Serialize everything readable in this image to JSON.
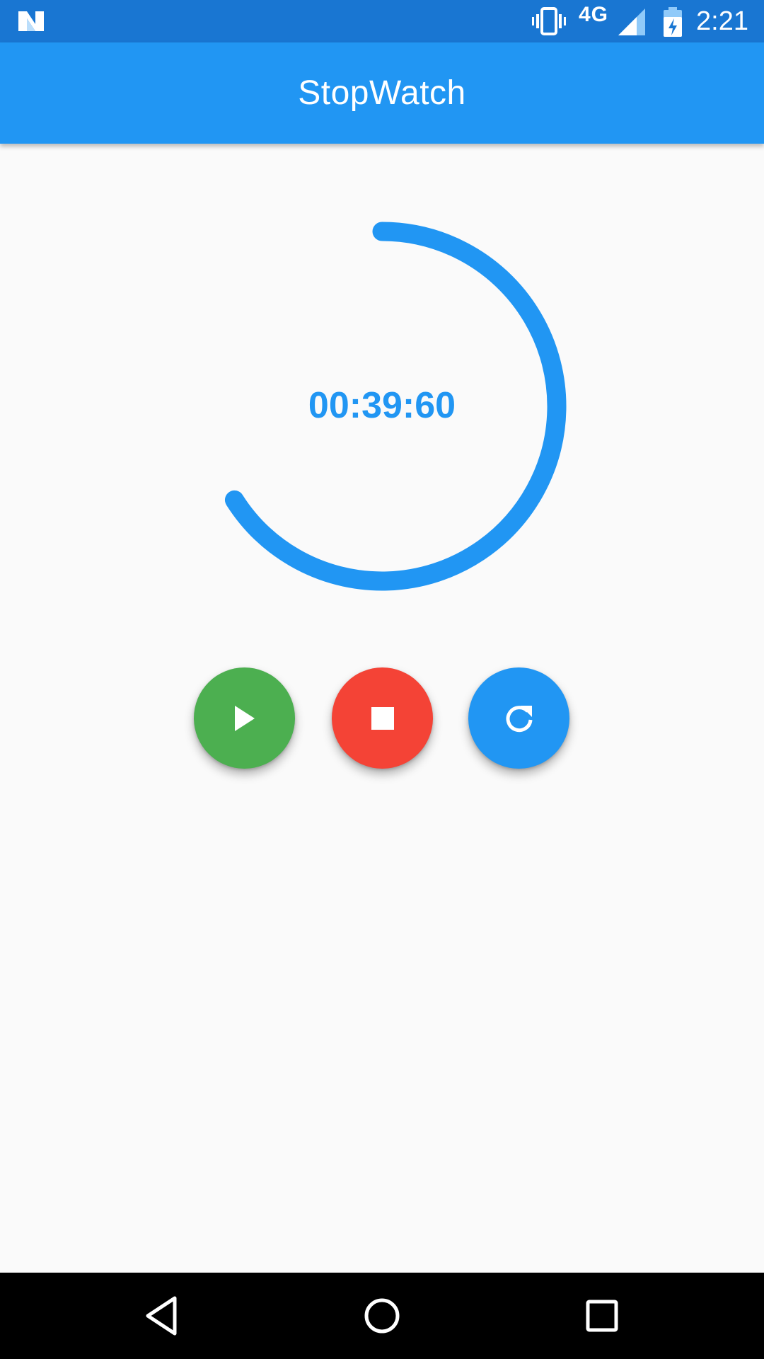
{
  "status_bar": {
    "network_type": "4G",
    "clock": "2:21",
    "icons": [
      "android-n-logo-icon",
      "vibrate-icon",
      "signal-icon",
      "battery-charging-icon"
    ]
  },
  "app_bar": {
    "title": "StopWatch"
  },
  "timer": {
    "elapsed": "00:39:60",
    "seconds_progress": 0.66,
    "progress_color": "#2196f3"
  },
  "controls": [
    {
      "name": "start",
      "icon": "play-icon",
      "color": "#4caf50"
    },
    {
      "name": "stop",
      "icon": "stop-icon",
      "color": "#f44336"
    },
    {
      "name": "reset",
      "icon": "refresh-icon",
      "color": "#2196f3"
    }
  ],
  "nav_bar": {
    "icons": [
      "back-icon",
      "home-icon",
      "recents-icon"
    ]
  }
}
